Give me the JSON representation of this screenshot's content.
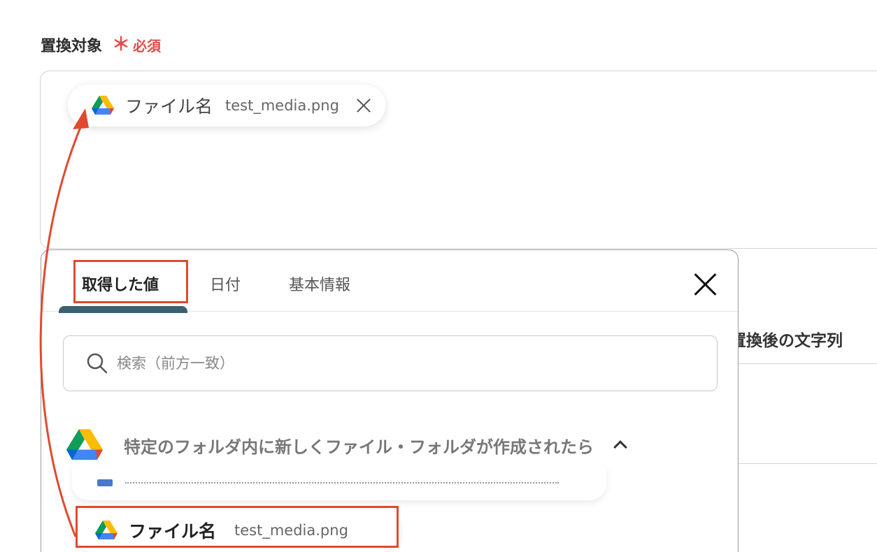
{
  "field": {
    "label": "置換対象",
    "required_mark": "＊",
    "required_text": "必須"
  },
  "selected_chip": {
    "icon": "google-drive-icon",
    "label": "ファイル名",
    "value": "test_media.png"
  },
  "background": {
    "replacement_label": "置換後の文字列"
  },
  "popup": {
    "tabs": [
      "取得した値",
      "日付",
      "基本情報"
    ],
    "active_tab": "取得した値",
    "search_placeholder": "検索（前方一致）",
    "section": {
      "icon": "google-drive-icon",
      "title": "特定のフォルダ内に新しくファイル・フォルダが作成されたら",
      "expanded": true
    },
    "item": {
      "icon": "google-drive-icon",
      "label": "ファイル名",
      "value": "test_media.png"
    }
  },
  "colors": {
    "required": "#e24b4b",
    "annotation": "#e04a2f",
    "tab_indicator": "#3b6070"
  }
}
